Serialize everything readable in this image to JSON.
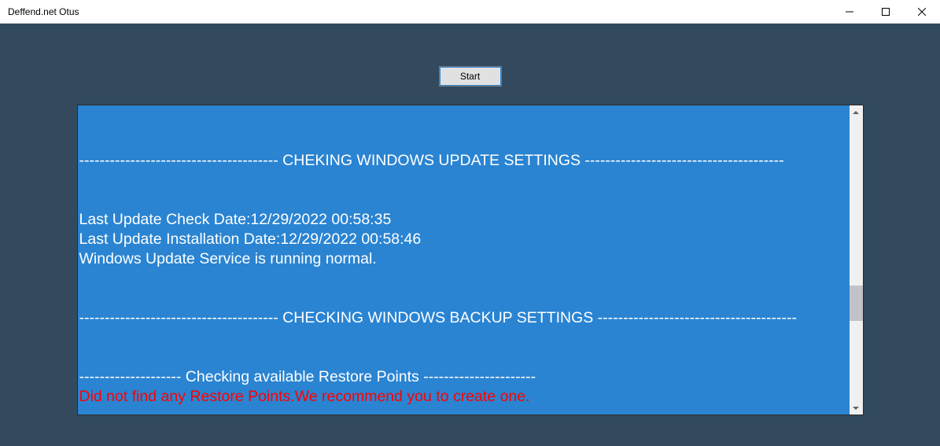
{
  "window": {
    "title": "Deffend.net Otus"
  },
  "toolbar": {
    "start_label": "Start"
  },
  "output": {
    "lines": [
      {
        "text": "",
        "color": "white"
      },
      {
        "text": "",
        "color": "white"
      },
      {
        "text": "--------------------------------------- CHEKING WINDOWS UPDATE SETTINGS ---------------------------------------",
        "color": "white"
      },
      {
        "text": "",
        "color": "white"
      },
      {
        "text": "",
        "color": "white"
      },
      {
        "text": "Last Update Check Date:12/29/2022 00:58:35",
        "color": "white"
      },
      {
        "text": "Last Update Installation Date:12/29/2022 00:58:46",
        "color": "white"
      },
      {
        "text": "Windows Update Service is running normal.",
        "color": "white"
      },
      {
        "text": "",
        "color": "white"
      },
      {
        "text": "",
        "color": "white"
      },
      {
        "text": "--------------------------------------- CHECKING WINDOWS BACKUP SETTINGS ---------------------------------------",
        "color": "white"
      },
      {
        "text": "",
        "color": "white"
      },
      {
        "text": "",
        "color": "white"
      },
      {
        "text": "-------------------- Checking available Restore Points ----------------------",
        "color": "white"
      },
      {
        "text": "Did not find any Restore Points.We recommend you to create one.",
        "color": "red"
      }
    ]
  }
}
